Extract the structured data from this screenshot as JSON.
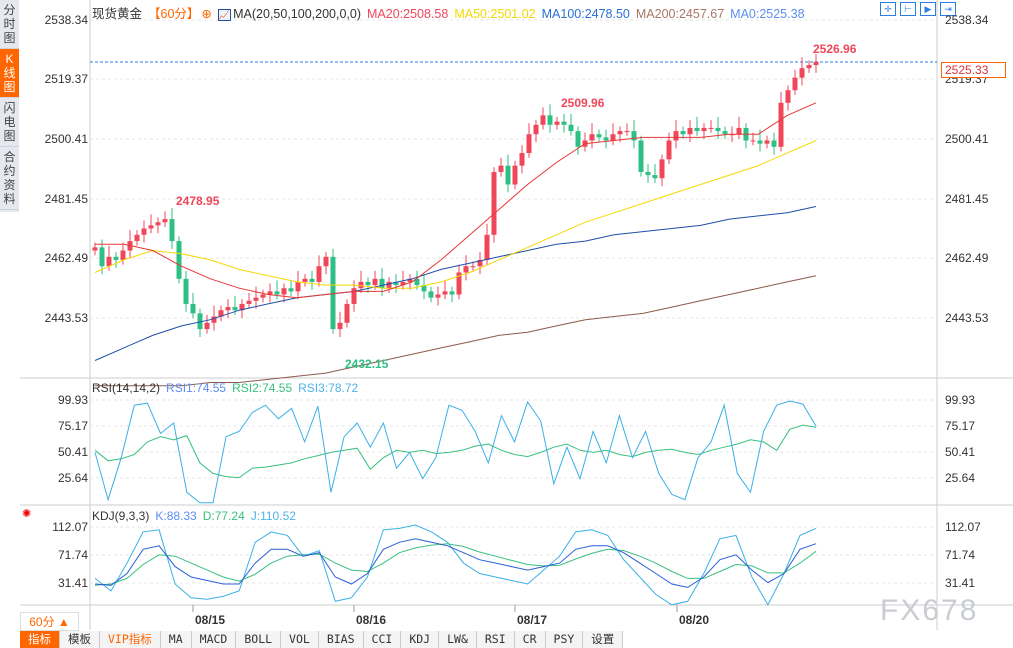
{
  "sidebar": [
    "分时图",
    "K线图",
    "闪电图",
    "合约资料"
  ],
  "header": {
    "title": "现货黄金",
    "period": "【60分】",
    "ma_label": "MA(20,50,100,200,0,0)",
    "ma20": "MA20:2508.58",
    "ma50": "MA50:2501.02",
    "ma100": "MA100:2478.50",
    "ma200": "MA200:2457.67",
    "ma0": "MA0:2525.38"
  },
  "toolbar": [
    "crosshair-icon",
    "zoom-range-icon",
    "play-icon",
    "exit-icon"
  ],
  "price_axis": [
    "2538.34",
    "2519.37",
    "2500.41",
    "2481.45",
    "2462.49",
    "2443.53"
  ],
  "current_price": "2525.33",
  "annotations": {
    "high": "2526.96",
    "peak2": "2509.96",
    "peak1": "2478.95",
    "low": "2432.15"
  },
  "rsi": {
    "label": "RSI(14,14,2)",
    "rsi1": "RSI1:74.55",
    "rsi2": "RSI2:74.55",
    "rsi3": "RSI3:78.72",
    "axis": [
      "99.93",
      "75.17",
      "50.41",
      "25.64"
    ]
  },
  "kdj": {
    "label": "KDJ(9,3,3)",
    "k": "K:88.33",
    "d": "D:77.24",
    "j": "J:110.52",
    "axis": [
      "112.07",
      "71.74",
      "31.41"
    ]
  },
  "dates": [
    "08/15",
    "08/16",
    "08/17",
    "08/20"
  ],
  "period_select": "60分 ▲",
  "tabs": [
    "指标",
    "模板",
    "VIP指标",
    "MA",
    "MACD",
    "BOLL",
    "VOL",
    "BIAS",
    "CCI",
    "KDJ",
    "LW&",
    "RSI",
    "CR",
    "PSY",
    "设置"
  ],
  "watermark": "FX678",
  "colors": {
    "up": "#f0465a",
    "down": "#2fbf85",
    "ma20": "#e53935",
    "ma50": "#f5d800",
    "ma100": "#1f4fa8",
    "ma200": "#8d5a4a",
    "accent": "#ff6600"
  },
  "chart_data": {
    "type": "candlestick",
    "closes": [
      2466,
      2460,
      2463,
      2462,
      2465,
      2468,
      2470,
      2472,
      2473,
      2474,
      2475,
      2468,
      2456,
      2448,
      2445,
      2440,
      2442,
      2444,
      2446,
      2447,
      2446,
      2448,
      2449,
      2450,
      2451,
      2452,
      2451,
      2453,
      2452,
      2455,
      2456,
      2455,
      2460,
      2463,
      2440,
      2442,
      2448,
      2453,
      2455,
      2454,
      2456,
      2453,
      2455,
      2454,
      2455,
      2456,
      2454,
      2452,
      2450,
      2451,
      2452,
      2451,
      2458,
      2460,
      2460,
      2462,
      2470,
      2490,
      2492,
      2486,
      2492,
      2496,
      2502,
      2505,
      2508,
      2505,
      2506,
      2505,
      2503,
      2498,
      2500,
      2502,
      2501,
      2500,
      2502,
      2503,
      2503,
      2500,
      2490,
      2489,
      2488,
      2494,
      2500,
      2503,
      2502,
      2504,
      2503,
      2504,
      2504,
      2503,
      2502,
      2502,
      2504,
      2500,
      2500,
      2499,
      2500,
      2498,
      2512,
      2516,
      2520,
      2523,
      2524,
      2525
    ],
    "ma20": [
      2467,
      2467,
      2465,
      2460,
      2456,
      2453,
      2451,
      2450,
      2451,
      2452,
      2452,
      2455,
      2462,
      2470,
      2478,
      2486,
      2493,
      2499,
      2500,
      2501,
      2501,
      2501,
      2502,
      2502,
      2508,
      2512
    ],
    "ma50": [
      2458,
      2462,
      2465,
      2464,
      2462,
      2459,
      2457,
      2455,
      2454,
      2454,
      2453,
      2453,
      2455,
      2458,
      2462,
      2466,
      2470,
      2474,
      2477,
      2480,
      2483,
      2486,
      2489,
      2492,
      2496,
      2500
    ],
    "ma100": [
      2430,
      2434,
      2438,
      2441,
      2443,
      2446,
      2448,
      2450,
      2451,
      2452,
      2454,
      2456,
      2459,
      2461,
      2463,
      2465,
      2467,
      2468,
      2470,
      2471,
      2472,
      2473,
      2475,
      2476,
      2477,
      2479
    ],
    "ma200": [
      2422,
      2422,
      2422,
      2422,
      2423,
      2423,
      2424,
      2425,
      2426,
      2428,
      2430,
      2432,
      2434,
      2436,
      2438,
      2439,
      2441,
      2443,
      2444,
      2445,
      2447,
      2449,
      2451,
      2453,
      2455,
      2457
    ],
    "price_range": [
      2430,
      2540
    ],
    "rsi1": [
      50,
      5,
      45,
      95,
      97,
      68,
      78,
      12,
      2,
      2,
      65,
      70,
      88,
      95,
      82,
      92,
      60,
      94,
      12,
      65,
      78,
      55,
      78,
      35,
      50,
      25,
      45,
      95,
      90,
      70,
      40,
      85,
      60,
      98,
      80,
      20,
      55,
      25,
      70,
      40,
      85,
      45,
      70,
      30,
      10,
      5,
      45,
      60,
      95,
      30,
      12,
      70,
      95,
      99,
      96,
      75
    ],
    "rsi2": [
      52,
      42,
      44,
      48,
      60,
      65,
      62,
      66,
      40,
      30,
      27,
      26,
      35,
      36,
      38,
      40,
      44,
      47,
      50,
      52,
      54,
      34,
      45,
      52,
      50,
      52,
      49,
      50,
      52,
      56,
      58,
      52,
      48,
      46,
      50,
      55,
      58,
      52,
      50,
      52,
      48,
      46,
      50,
      52,
      53,
      50,
      48,
      52,
      55,
      58,
      62,
      60,
      52,
      72,
      76,
      74
    ],
    "kdj_k": [
      30,
      28,
      45,
      80,
      85,
      55,
      40,
      35,
      30,
      30,
      60,
      80,
      80,
      70,
      75,
      40,
      30,
      45,
      80,
      90,
      95,
      90,
      85,
      75,
      65,
      60,
      55,
      50,
      55,
      60,
      80,
      85,
      85,
      75,
      60,
      45,
      30,
      25,
      40,
      65,
      72,
      50,
      32,
      45,
      80,
      88
    ],
    "kdj_d": [
      28,
      30,
      38,
      58,
      72,
      70,
      60,
      50,
      40,
      34,
      44,
      60,
      70,
      72,
      73,
      60,
      50,
      48,
      60,
      75,
      82,
      86,
      88,
      84,
      76,
      70,
      64,
      58,
      56,
      57,
      66,
      74,
      80,
      78,
      70,
      60,
      48,
      38,
      38,
      48,
      58,
      56,
      46,
      46,
      60,
      77
    ],
    "kdj_j": [
      38,
      20,
      60,
      105,
      108,
      30,
      10,
      8,
      12,
      20,
      90,
      105,
      100,
      70,
      78,
      5,
      10,
      40,
      108,
      110,
      115,
      105,
      90,
      60,
      45,
      40,
      35,
      30,
      50,
      70,
      105,
      108,
      100,
      65,
      40,
      15,
      0,
      5,
      45,
      95,
      100,
      40,
      0,
      45,
      100,
      110
    ]
  }
}
